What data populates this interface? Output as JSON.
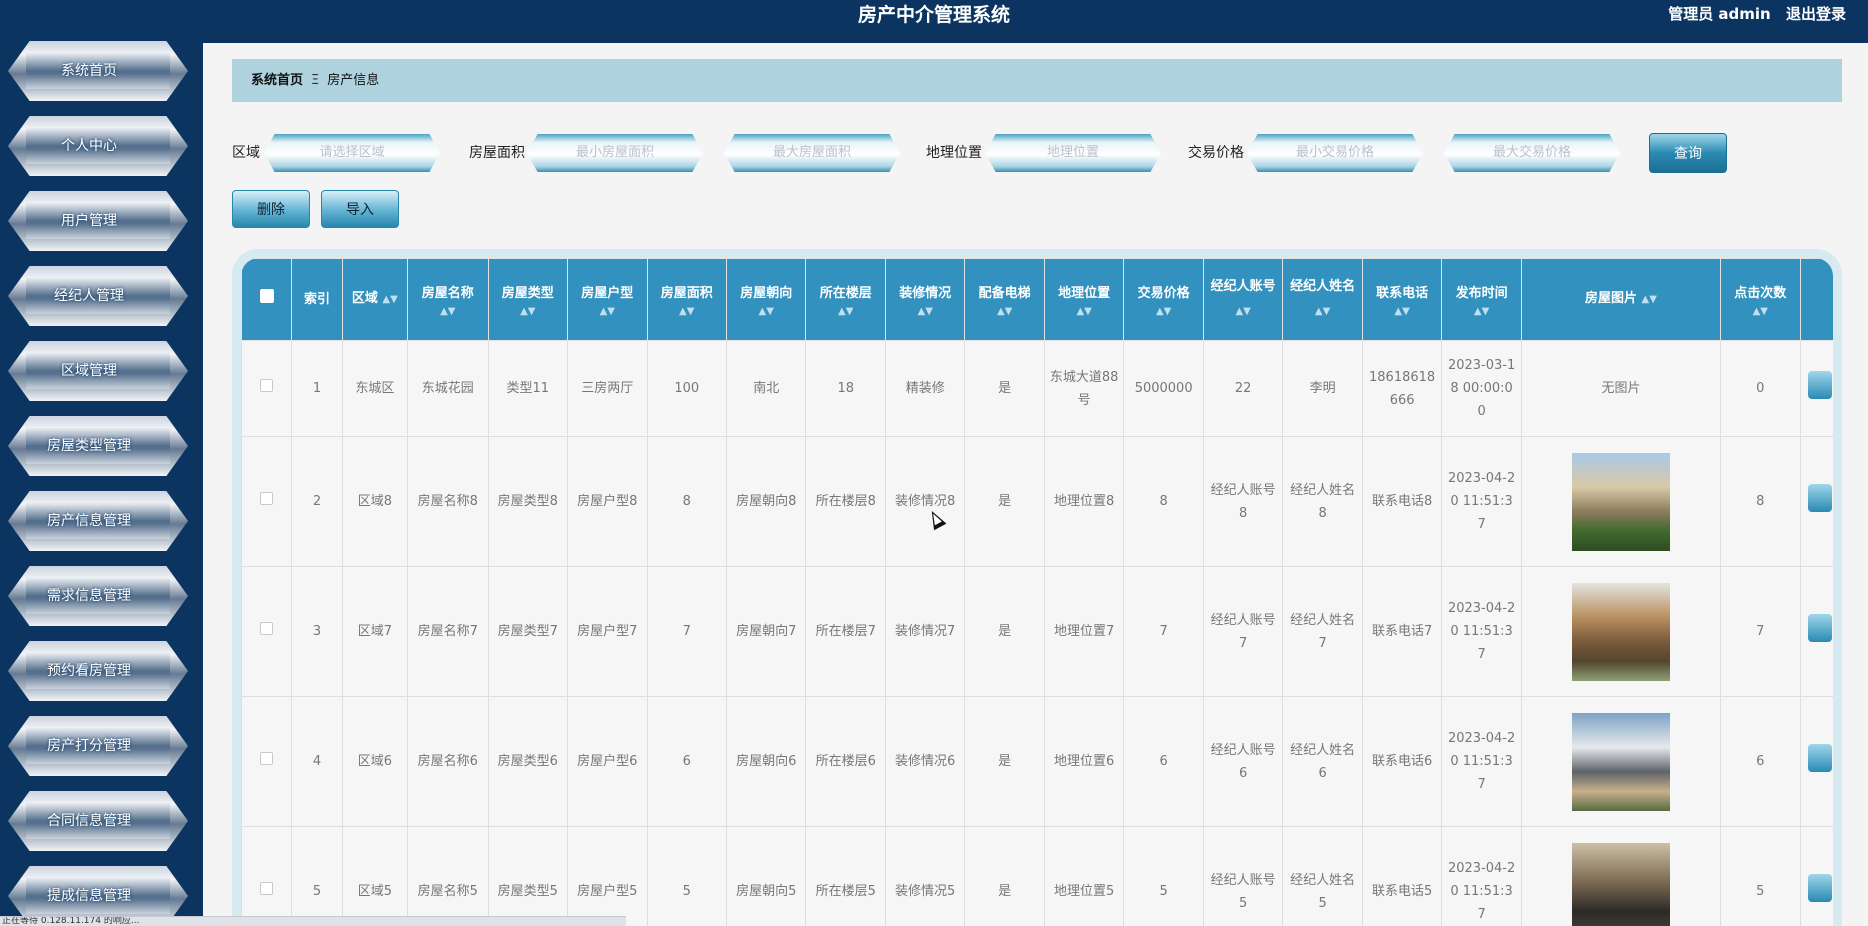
{
  "header": {
    "title": "房产中介管理系统",
    "user_label": "管理员 admin",
    "logout_label": "退出登录"
  },
  "sidebar": {
    "items": [
      {
        "label": "系统首页"
      },
      {
        "label": "个人中心"
      },
      {
        "label": "用户管理"
      },
      {
        "label": "经纪人管理"
      },
      {
        "label": "区域管理"
      },
      {
        "label": "房屋类型管理"
      },
      {
        "label": "房产信息管理"
      },
      {
        "label": "需求信息管理"
      },
      {
        "label": "预约看房管理"
      },
      {
        "label": "房产打分管理"
      },
      {
        "label": "合同信息管理"
      },
      {
        "label": "提成信息管理"
      }
    ]
  },
  "breadcrumb": {
    "home": "系统首页",
    "separator": "Ξ",
    "current": "房产信息"
  },
  "filters": {
    "area_label": "区域",
    "area_placeholder": "请选择区域",
    "size_label": "房屋面积",
    "size_min_placeholder": "最小房屋面积",
    "size_max_placeholder": "最大房屋面积",
    "location_label": "地理位置",
    "location_placeholder": "地理位置",
    "price_label": "交易价格",
    "price_min_placeholder": "最小交易价格",
    "price_max_placeholder": "最大交易价格",
    "query_label": "查询"
  },
  "actions": {
    "delete_label": "删除",
    "import_label": "导入"
  },
  "table": {
    "columns": [
      "索引",
      "区域",
      "房屋名称",
      "房屋类型",
      "房屋户型",
      "房屋面积",
      "房屋朝向",
      "所在楼层",
      "装修情况",
      "配备电梯",
      "地理位置",
      "交易价格",
      "经纪人账号",
      "经纪人姓名",
      "联系电话",
      "发布时间",
      "房屋图片",
      "点击次数"
    ],
    "rows": [
      {
        "index": "1",
        "area": "东城区",
        "name": "东城花园",
        "type": "类型11",
        "layout": "三房两厅",
        "size": "100",
        "orientation": "南北",
        "floor": "18",
        "decor": "精装修",
        "elevator": "是",
        "location": "东城大道88号",
        "price": "5000000",
        "agent_account": "22",
        "agent_name": "李明",
        "phone": "18618618666",
        "time": "2023-03-18 00:00:00",
        "image": "无图片",
        "clicks": "0"
      },
      {
        "index": "2",
        "area": "区域8",
        "name": "房屋名称8",
        "type": "房屋类型8",
        "layout": "房屋户型8",
        "size": "8",
        "orientation": "房屋朝向8",
        "floor": "所在楼层8",
        "decor": "装修情况8",
        "elevator": "是",
        "location": "地理位置8",
        "price": "8",
        "agent_account": "经纪人账号8",
        "agent_name": "经纪人姓名8",
        "phone": "联系电话8",
        "time": "2023-04-20 11:51:37",
        "image": "",
        "clicks": "8"
      },
      {
        "index": "3",
        "area": "区域7",
        "name": "房屋名称7",
        "type": "房屋类型7",
        "layout": "房屋户型7",
        "size": "7",
        "orientation": "房屋朝向7",
        "floor": "所在楼层7",
        "decor": "装修情况7",
        "elevator": "是",
        "location": "地理位置7",
        "price": "7",
        "agent_account": "经纪人账号7",
        "agent_name": "经纪人姓名7",
        "phone": "联系电话7",
        "time": "2023-04-20 11:51:37",
        "image": "",
        "clicks": "7"
      },
      {
        "index": "4",
        "area": "区域6",
        "name": "房屋名称6",
        "type": "房屋类型6",
        "layout": "房屋户型6",
        "size": "6",
        "orientation": "房屋朝向6",
        "floor": "所在楼层6",
        "decor": "装修情况6",
        "elevator": "是",
        "location": "地理位置6",
        "price": "6",
        "agent_account": "经纪人账号6",
        "agent_name": "经纪人姓名6",
        "phone": "联系电话6",
        "time": "2023-04-20 11:51:37",
        "image": "",
        "clicks": "6"
      },
      {
        "index": "5",
        "area": "区域5",
        "name": "房屋名称5",
        "type": "房屋类型5",
        "layout": "房屋户型5",
        "size": "5",
        "orientation": "房屋朝向5",
        "floor": "所在楼层5",
        "decor": "装修情况5",
        "elevator": "是",
        "location": "地理位置5",
        "price": "5",
        "agent_account": "经纪人账号5",
        "agent_name": "经纪人姓名5",
        "phone": "联系电话5",
        "time": "2023-04-20 11:51:37",
        "image": "",
        "clicks": "5"
      }
    ]
  },
  "statusbar": {
    "text": "正在等待 0.128.11.174 的响应..."
  }
}
